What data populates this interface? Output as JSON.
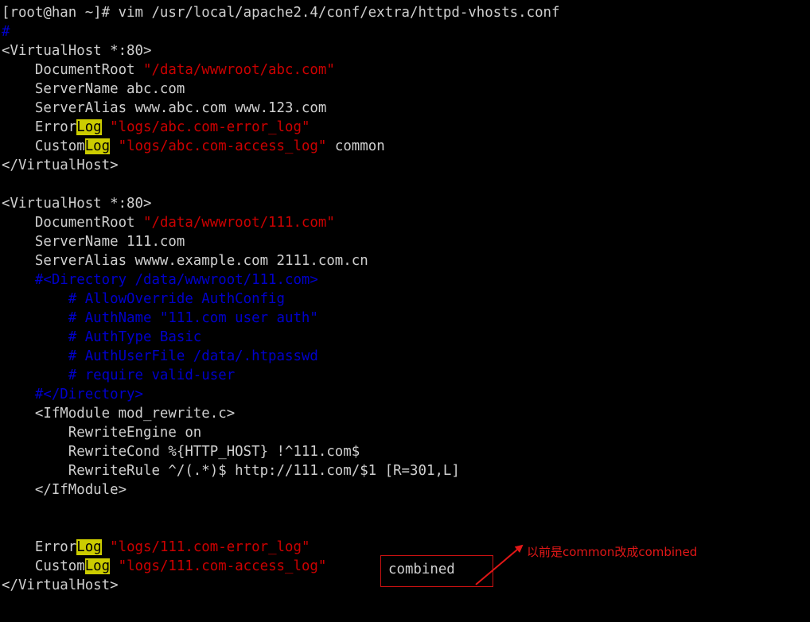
{
  "window": {
    "background_color": "#000000",
    "foreground_color": "#cccccc",
    "title": "root@han: ~"
  },
  "colors": {
    "default_text": "#cfcfcf",
    "string": "#cc0000",
    "comment": "#0000cc",
    "search_match_bg": "#cccc00",
    "search_match_fg": "#000000",
    "annotation": "#cc1111"
  },
  "terminal": {
    "prompt": "[root@han ~]# ",
    "command": "vim /usr/local/apache2.4/conf/extra/httpd-vhosts.conf",
    "search_term": "Log",
    "lines": [
      {
        "id": "line-1",
        "segments": [
          {
            "text": "[root@han ~]# vim /usr/local/apache2.4/conf/extra/httpd-vhosts.conf",
            "style": "default"
          }
        ]
      },
      {
        "id": "line-2",
        "segments": [
          {
            "text": "#",
            "style": "comment"
          }
        ]
      },
      {
        "id": "line-3",
        "segments": [
          {
            "text": "<VirtualHost *:80>",
            "style": "default"
          }
        ]
      },
      {
        "id": "line-4",
        "segments": [
          {
            "text": "    DocumentRoot ",
            "style": "default"
          },
          {
            "text": "\"/data/wwwroot/abc.com\"",
            "style": "string"
          }
        ]
      },
      {
        "id": "line-5",
        "segments": [
          {
            "text": "    ServerName abc.com",
            "style": "default"
          }
        ]
      },
      {
        "id": "line-6",
        "segments": [
          {
            "text": "    ServerAlias www.abc.com www.123.com",
            "style": "default"
          }
        ]
      },
      {
        "id": "line-7",
        "segments": [
          {
            "text": "    Error",
            "style": "default"
          },
          {
            "text": "Log",
            "style": "match"
          },
          {
            "text": " ",
            "style": "default"
          },
          {
            "text": "\"logs/abc.com-error_log\"",
            "style": "string"
          }
        ]
      },
      {
        "id": "line-8",
        "segments": [
          {
            "text": "    Custom",
            "style": "default"
          },
          {
            "text": "Log",
            "style": "match"
          },
          {
            "text": " ",
            "style": "default"
          },
          {
            "text": "\"logs/abc.com-access_log\"",
            "style": "string"
          },
          {
            "text": " common",
            "style": "default"
          }
        ]
      },
      {
        "id": "line-9",
        "segments": [
          {
            "text": "</VirtualHost>",
            "style": "default"
          }
        ]
      },
      {
        "id": "line-10",
        "segments": [
          {
            "text": "",
            "style": "default"
          }
        ]
      },
      {
        "id": "line-11",
        "segments": [
          {
            "text": "<VirtualHost *:80>",
            "style": "default"
          }
        ]
      },
      {
        "id": "line-12",
        "segments": [
          {
            "text": "    DocumentRoot ",
            "style": "default"
          },
          {
            "text": "\"/data/wwwroot/111.com\"",
            "style": "string"
          }
        ]
      },
      {
        "id": "line-13",
        "segments": [
          {
            "text": "    ServerName 111.com",
            "style": "default"
          }
        ]
      },
      {
        "id": "line-14",
        "segments": [
          {
            "text": "    ServerAlias wwww.example.com 2111.com.cn",
            "style": "default"
          }
        ]
      },
      {
        "id": "line-15",
        "segments": [
          {
            "text": "    #<Directory /data/wwwroot/111.com>",
            "style": "comment"
          }
        ]
      },
      {
        "id": "line-16",
        "segments": [
          {
            "text": "        # AllowOverride AuthConfig",
            "style": "comment"
          }
        ]
      },
      {
        "id": "line-17",
        "segments": [
          {
            "text": "        # AuthName \"111.com user auth\"",
            "style": "comment"
          }
        ]
      },
      {
        "id": "line-18",
        "segments": [
          {
            "text": "        # AuthType Basic",
            "style": "comment"
          }
        ]
      },
      {
        "id": "line-19",
        "segments": [
          {
            "text": "        # AuthUserFile /data/.htpasswd",
            "style": "comment"
          }
        ]
      },
      {
        "id": "line-20",
        "segments": [
          {
            "text": "        # require valid-user",
            "style": "comment"
          }
        ]
      },
      {
        "id": "line-21",
        "segments": [
          {
            "text": "    #</Directory>",
            "style": "comment"
          }
        ]
      },
      {
        "id": "line-22",
        "segments": [
          {
            "text": "    <IfModule mod_rewrite.c>",
            "style": "default"
          }
        ]
      },
      {
        "id": "line-23",
        "segments": [
          {
            "text": "        RewriteEngine on",
            "style": "default"
          }
        ]
      },
      {
        "id": "line-24",
        "segments": [
          {
            "text": "        RewriteCond %{HTTP_HOST} !^111.com$",
            "style": "default"
          }
        ]
      },
      {
        "id": "line-25",
        "segments": [
          {
            "text": "        RewriteRule ^/(.*)$ http://111.com/$1 [R=301,L]",
            "style": "default"
          }
        ]
      },
      {
        "id": "line-26",
        "segments": [
          {
            "text": "    </IfModule>",
            "style": "default"
          }
        ]
      },
      {
        "id": "line-27",
        "segments": [
          {
            "text": "",
            "style": "default"
          }
        ]
      },
      {
        "id": "line-28",
        "segments": [
          {
            "text": "",
            "style": "default"
          }
        ]
      },
      {
        "id": "line-29",
        "segments": [
          {
            "text": "    Error",
            "style": "default"
          },
          {
            "text": "Log",
            "style": "match"
          },
          {
            "text": " ",
            "style": "default"
          },
          {
            "text": "\"logs/111.com-error_log\"",
            "style": "string"
          }
        ]
      },
      {
        "id": "line-30",
        "segments": [
          {
            "text": "    Custom",
            "style": "default"
          },
          {
            "text": "Log",
            "style": "match"
          },
          {
            "text": " ",
            "style": "default"
          },
          {
            "text": "\"logs/111.com-access_log\"",
            "style": "string"
          },
          {
            "text": " ",
            "style": "default"
          }
        ]
      },
      {
        "id": "line-31",
        "segments": [
          {
            "text": "</VirtualHost>",
            "style": "default"
          }
        ]
      }
    ]
  },
  "annotation": {
    "highlighted_value": "combined",
    "note_text": "以前是common改成combined",
    "box_color": "#cc1111",
    "arrow_color": "#e01717"
  }
}
